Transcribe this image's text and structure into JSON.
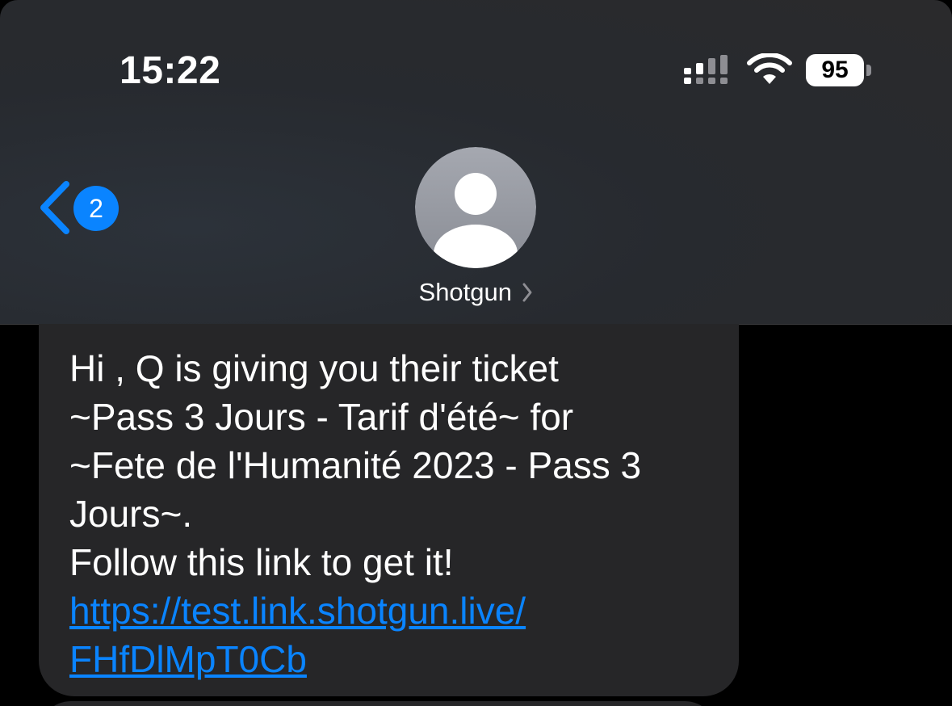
{
  "status_bar": {
    "time": "15:22",
    "signal_icon": "cellular-signal-icon",
    "wifi_icon": "wifi-icon",
    "battery_level": "95"
  },
  "nav": {
    "back_icon": "chevron-left-icon",
    "unread_count": "2",
    "contact_name": "Shotgun",
    "avatar_icon": "person-avatar-icon",
    "contact_chevron_icon": "chevron-right-icon"
  },
  "message": {
    "text": "Hi , Q is giving you their ticket\n~Pass 3 Jours - Tarif d'été~ for\n~Fete de l'Humanité 2023 - Pass 3\nJours~.\nFollow this link to get it!",
    "link": "https://test.link.shotgun.live/\nFHfDlMpT0Cb"
  },
  "colors": {
    "accent": "#0a84ff",
    "bubble": "#262628",
    "header": "#2a2a2c",
    "background": "#000000"
  }
}
